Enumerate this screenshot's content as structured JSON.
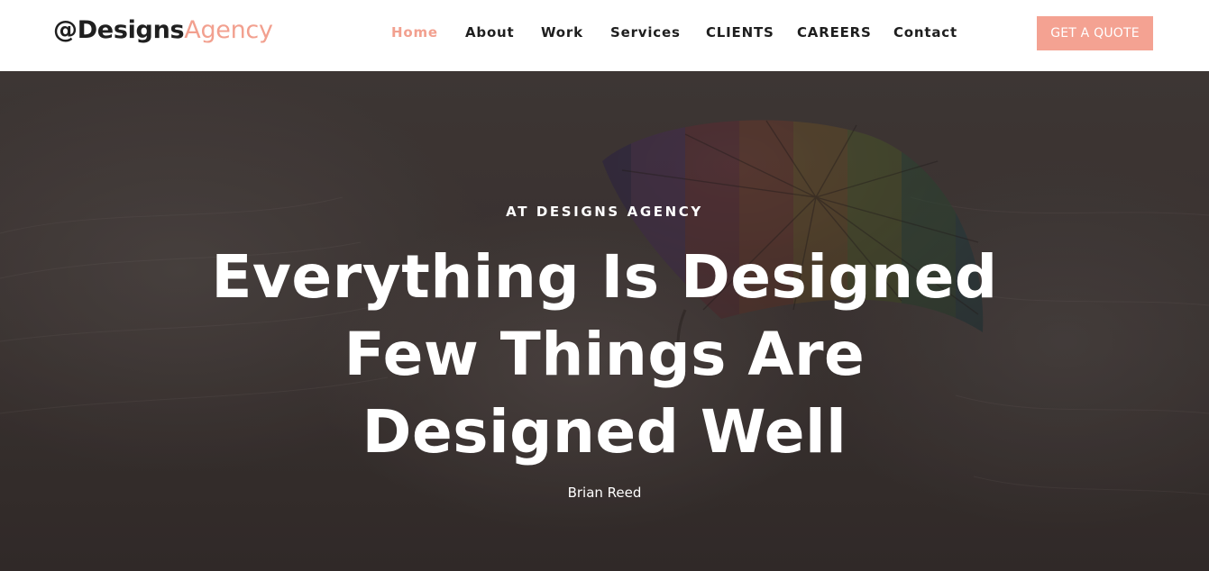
{
  "brand": {
    "name": "@Designs",
    "accent": "Agency"
  },
  "nav": {
    "items": [
      {
        "label": "Home",
        "active": true
      },
      {
        "label": "About",
        "active": false
      },
      {
        "label": "Work",
        "active": false
      },
      {
        "label": "Services",
        "active": false
      },
      {
        "label": "CLIENTS",
        "active": false
      },
      {
        "label": "CAREERS",
        "active": false
      },
      {
        "label": "Contact",
        "active": false
      }
    ],
    "cta_label": "GET A QUOTE"
  },
  "hero": {
    "eyebrow": "AT DESIGNS AGENCY",
    "headline_lines": [
      "Everything Is Designed",
      "Few Things Are",
      "Designed Well"
    ],
    "author": "Brian Reed",
    "background_image": "rainbow-umbrella-in-stormy-sky"
  },
  "colors": {
    "accent": "#f2a08f",
    "button_bg": "#f4a292",
    "nav_text": "#1e1e1e",
    "hero_text": "#ffffff"
  }
}
